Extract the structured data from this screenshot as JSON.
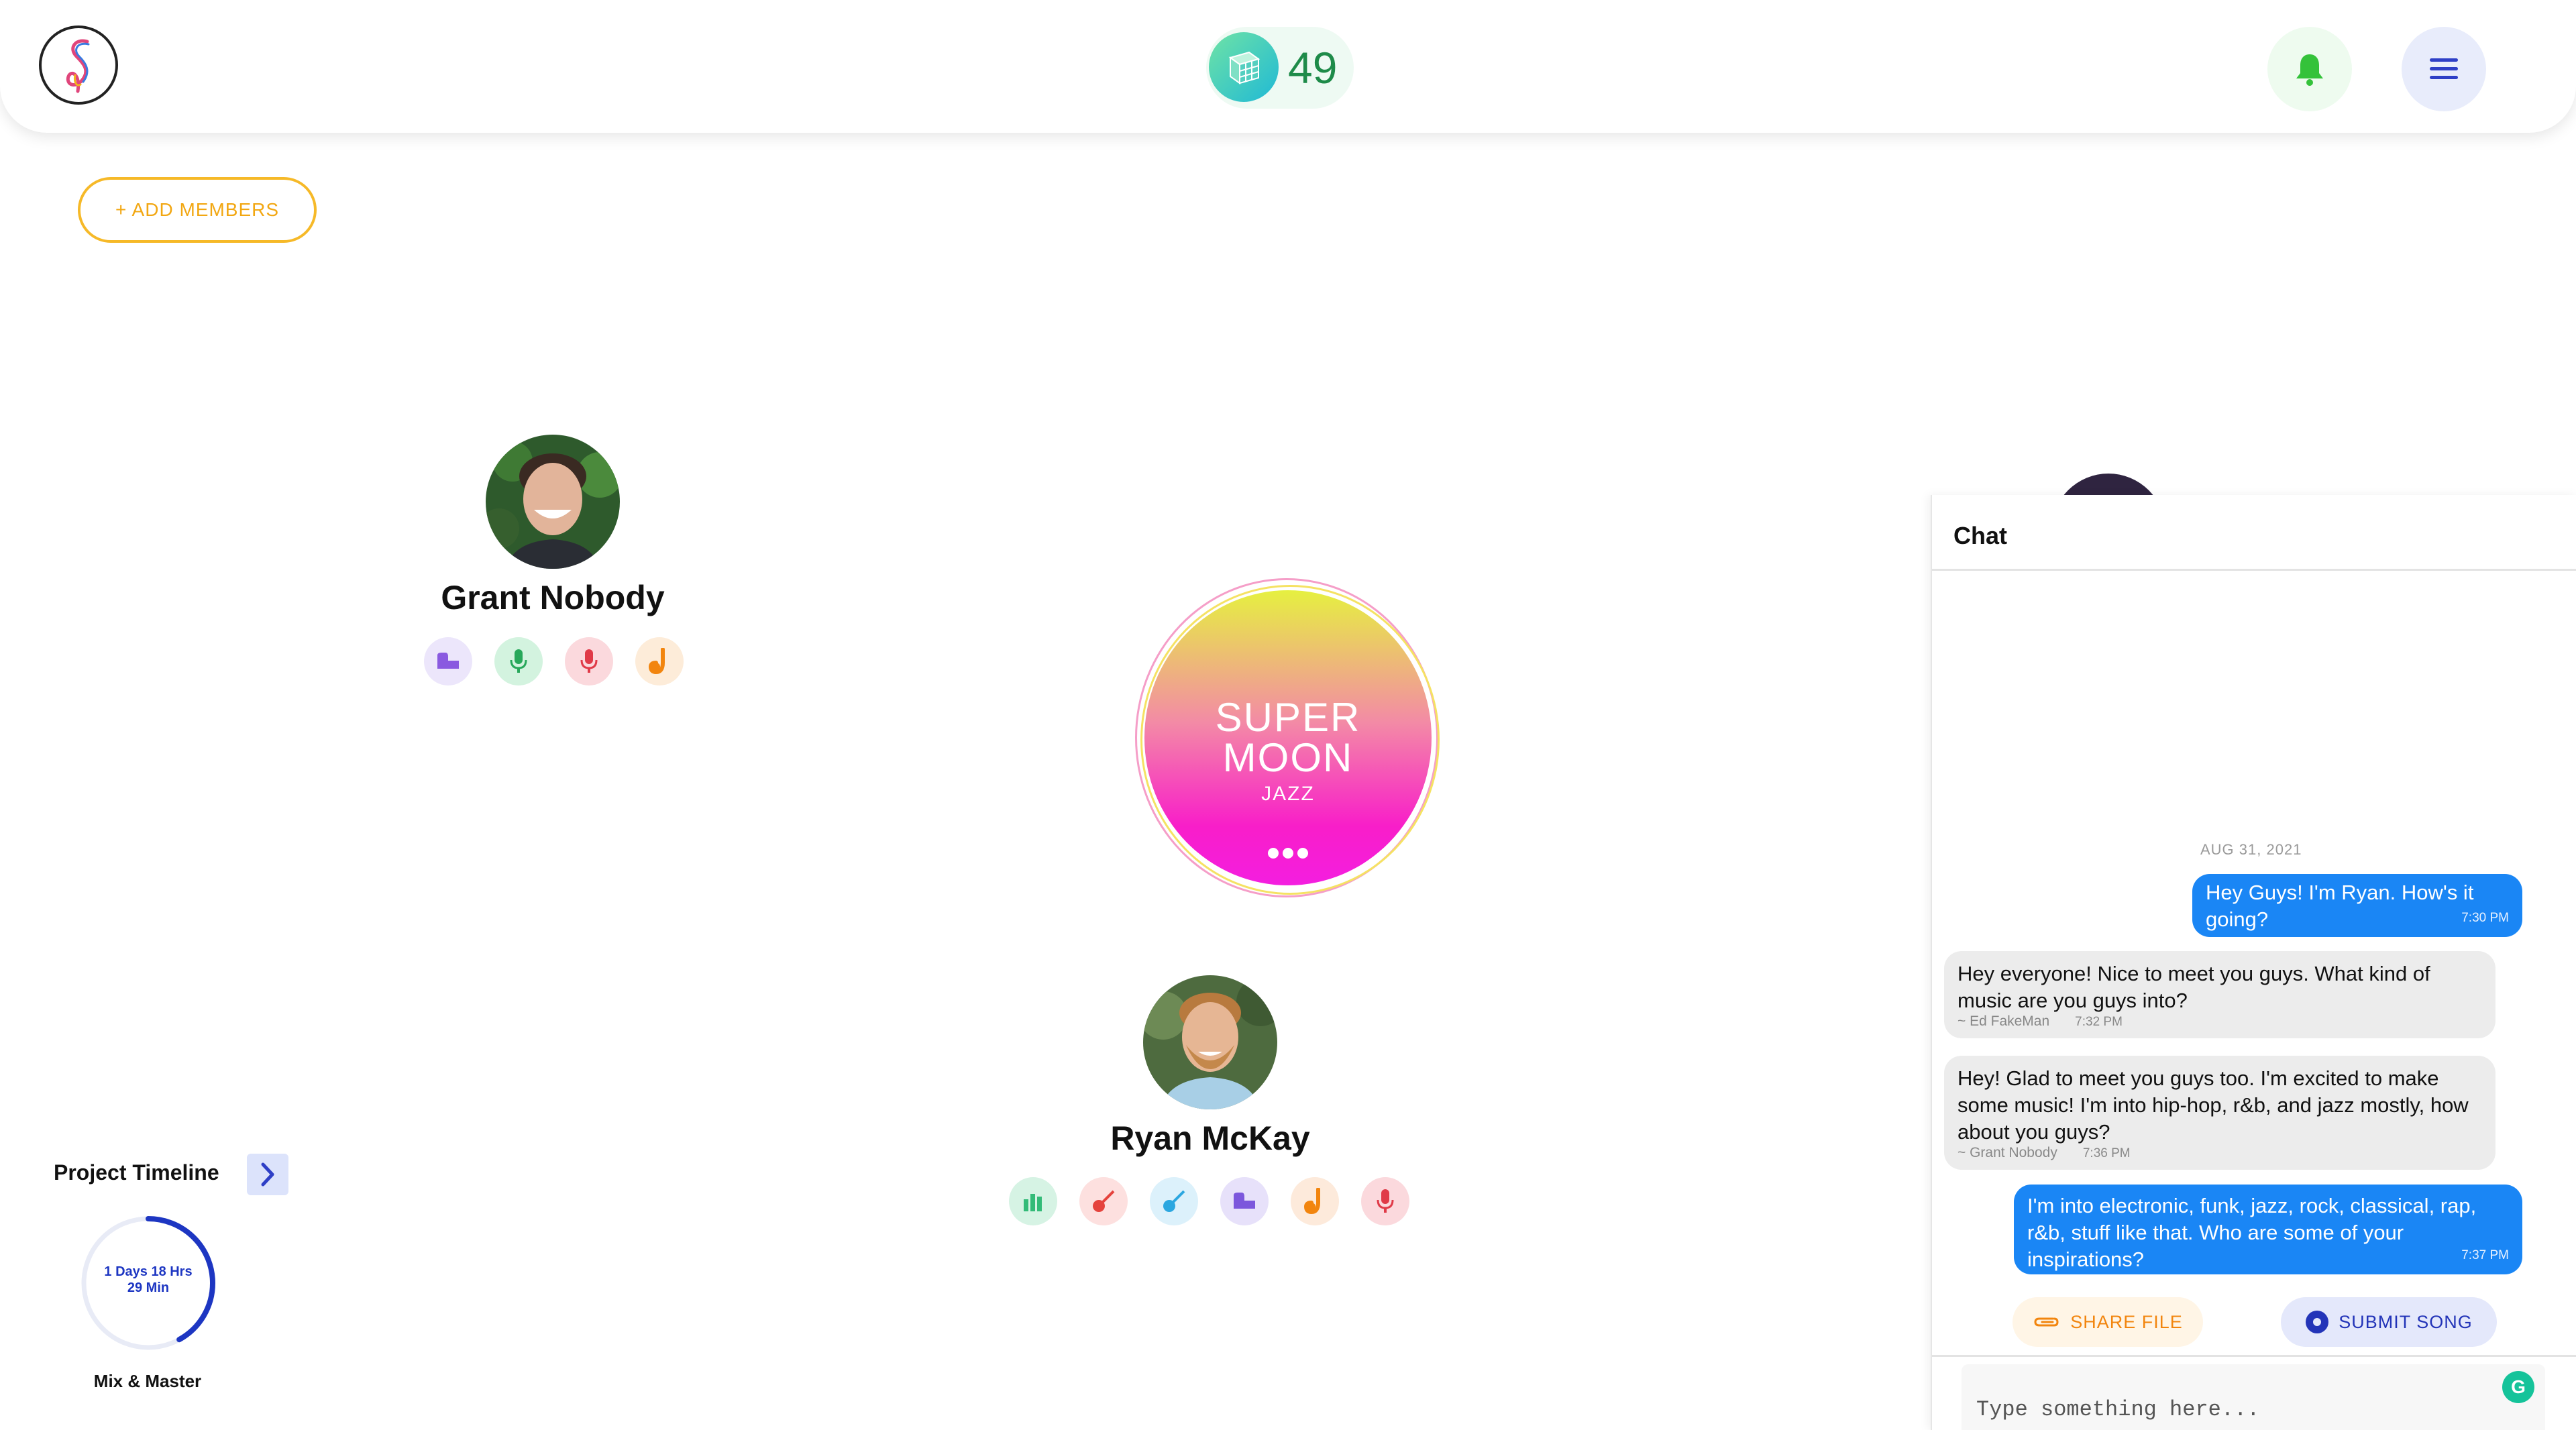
{
  "header": {
    "credits": "49",
    "icons": {
      "logo": "app-logo",
      "credits": "cube-coin-icon",
      "bell": "bell-icon",
      "menu": "hamburger-menu-icon"
    },
    "colors": {
      "credits_text": "#1e8b49",
      "bell": "#34c23a",
      "menu": "#2e3fc6"
    }
  },
  "add_members": {
    "label": "+ ADD MEMBERS",
    "color": "#f6b928"
  },
  "members": [
    {
      "name": "Grant Nobody",
      "roles": [
        {
          "icon": "piano-icon",
          "bg": "#ece6fb",
          "fg": "#8a5ae0"
        },
        {
          "icon": "microphone-icon",
          "bg": "#d3f3df",
          "fg": "#27a85a"
        },
        {
          "icon": "microphone-icon",
          "bg": "#fbd9dd",
          "fg": "#e03a48"
        },
        {
          "icon": "saxophone-icon",
          "bg": "#fdecd9",
          "fg": "#f2850e"
        }
      ]
    },
    {
      "name": "Ryan McKay",
      "roles": [
        {
          "icon": "mixer-icon",
          "bg": "#d6f3e4",
          "fg": "#33bb78"
        },
        {
          "icon": "guitar-icon",
          "bg": "#fde0df",
          "fg": "#e5433d"
        },
        {
          "icon": "guitar-icon",
          "bg": "#dcf1fb",
          "fg": "#2ba7e0"
        },
        {
          "icon": "piano-icon",
          "bg": "#e7e1fa",
          "fg": "#7c57dc"
        },
        {
          "icon": "saxophone-icon",
          "bg": "#fdeadb",
          "fg": "#f2850e"
        },
        {
          "icon": "microphone-icon",
          "bg": "#fbd9dd",
          "fg": "#e03a48"
        }
      ]
    }
  ],
  "song": {
    "title_line1": "SUPER",
    "title_line2": "MOON",
    "genre": "JAZZ"
  },
  "timeline": {
    "title": "Project Timeline",
    "time_line1": "1 Days 18 Hrs",
    "time_line2": "29 Min",
    "stage": "Mix & Master",
    "progress": 0.42,
    "color": "#1d36c2"
  },
  "chat": {
    "title": "Chat",
    "date": "AUG 31, 2021",
    "messages": [
      {
        "direction": "out",
        "text": "Hey Guys! I'm Ryan. How's it going?",
        "time": "7:30 PM"
      },
      {
        "direction": "in",
        "text": "Hey everyone! Nice to meet you guys. What kind of music are you guys into?",
        "sender": "~ Ed FakeMan",
        "time": "7:32 PM"
      },
      {
        "direction": "in",
        "text": "Hey! Glad to meet you guys too. I'm excited to make some music! I'm into hip-hop, r&b, and jazz mostly, how about you guys?",
        "sender": "~ Grant Nobody",
        "time": "7:36 PM"
      },
      {
        "direction": "out",
        "text": "I'm into electronic, funk, jazz, rock, classical, rap, r&b, stuff like that. Who are some of your inspirations?",
        "time": "7:37 PM"
      }
    ],
    "share_label": "SHARE FILE",
    "submit_label": "SUBMIT SONG",
    "input_placeholder": "Type something here...",
    "input_value": ""
  }
}
